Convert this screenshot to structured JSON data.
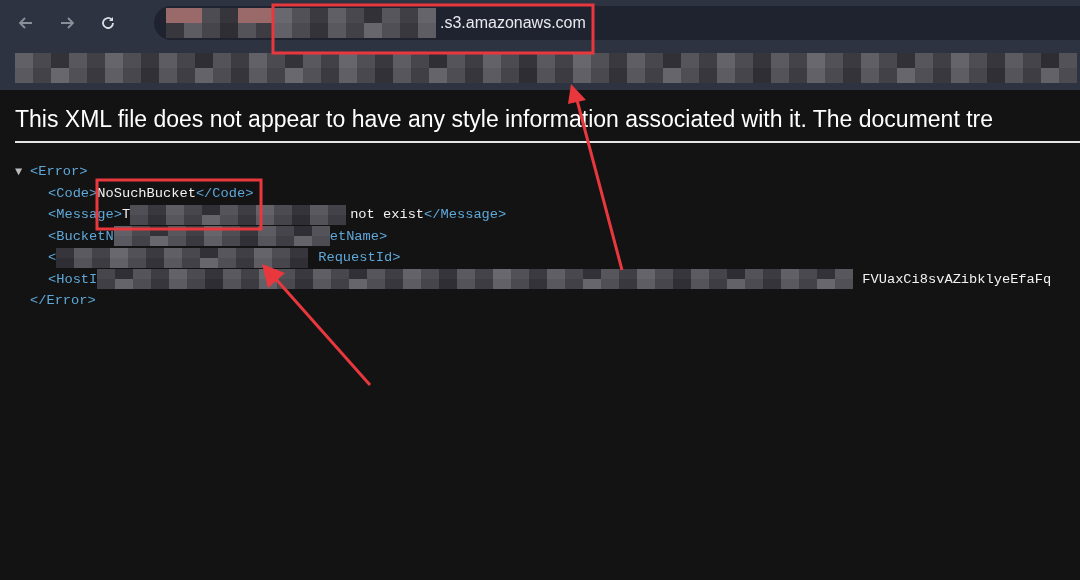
{
  "address_bar": {
    "url_visible": ".s3.amazonaws.com"
  },
  "banner": {
    "text": "This XML file does not appear to have any style information associated with it. The document tre"
  },
  "xml": {
    "toggle": "▼",
    "expanded": true,
    "lines": [
      {
        "segments": [
          {
            "kind": "tag",
            "text": "<Error>"
          }
        ]
      },
      {
        "segments": [
          {
            "kind": "tag",
            "text": "<Code>"
          },
          {
            "kind": "text",
            "text": "NoSuchBucket"
          },
          {
            "kind": "tag",
            "text": "</Code>"
          }
        ]
      },
      {
        "segments": [
          {
            "kind": "tag",
            "text": "<Message>"
          },
          {
            "kind": "text",
            "text": "T"
          },
          {
            "kind": "redacted"
          },
          {
            "kind": "text",
            "text": "not exist"
          },
          {
            "kind": "tag",
            "text": "</Message>"
          }
        ]
      },
      {
        "segments": [
          {
            "kind": "tag",
            "text": "<BucketN"
          },
          {
            "kind": "redacted"
          },
          {
            "kind": "tag",
            "text": "etName>"
          }
        ]
      },
      {
        "segments": [
          {
            "kind": "tag",
            "text": "<"
          },
          {
            "kind": "redacted"
          },
          {
            "kind": "tag",
            "text": "RequestId>"
          }
        ]
      },
      {
        "segments": [
          {
            "kind": "tag",
            "text": "<HostI"
          },
          {
            "kind": "redacted"
          },
          {
            "kind": "text",
            "text": "FVUaxCi8svAZibklyeEfaFq"
          }
        ]
      },
      {
        "segments": [
          {
            "kind": "tag",
            "text": "</Error>"
          }
        ]
      }
    ]
  }
}
